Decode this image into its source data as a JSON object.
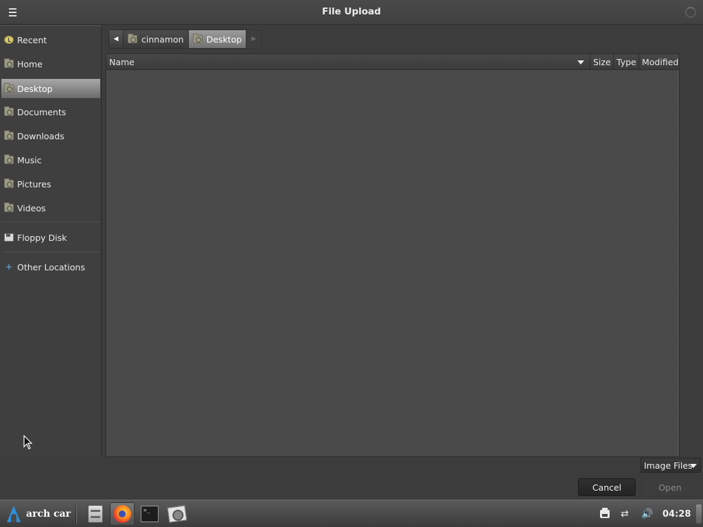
{
  "window": {
    "title": "File Upload",
    "menu_icon": "hamburger-menu-icon",
    "status_icon": "spinner-icon"
  },
  "sidebar": {
    "items": [
      {
        "label": "Recent",
        "icon": "recent-icon"
      },
      {
        "label": "Home",
        "icon": "folder-icon"
      },
      {
        "label": "Desktop",
        "icon": "folder-icon",
        "active": true
      },
      {
        "label": "Documents",
        "icon": "folder-icon"
      },
      {
        "label": "Downloads",
        "icon": "folder-icon"
      },
      {
        "label": "Music",
        "icon": "folder-icon"
      },
      {
        "label": "Pictures",
        "icon": "folder-icon"
      },
      {
        "label": "Videos",
        "icon": "folder-icon"
      },
      {
        "label": "Floppy Disk",
        "icon": "floppy-icon"
      },
      {
        "label": "Other Locations",
        "icon": "plus-icon"
      }
    ]
  },
  "pathbar": {
    "crumbs": [
      {
        "label": "cinnamon",
        "icon": "folder-icon"
      },
      {
        "label": "Desktop",
        "icon": "folder-icon",
        "active": true
      }
    ]
  },
  "filelist": {
    "columns": [
      "Name",
      "Size",
      "Type",
      "Modified"
    ],
    "rows": []
  },
  "filter": {
    "selected": "Image Files"
  },
  "actions": {
    "cancel_label": "Cancel",
    "open_label": "Open",
    "open_enabled": false
  },
  "taskbar": {
    "start_label": "arch car",
    "apps": [
      "file-manager-icon",
      "firefox-icon",
      "terminal-icon",
      "image-viewer-icon"
    ],
    "tray_icons": [
      "printer-icon",
      "network-icon",
      "volume-icon"
    ],
    "clock": "04:28",
    "colors": {
      "accent_logo": "#2f8fd8"
    }
  }
}
